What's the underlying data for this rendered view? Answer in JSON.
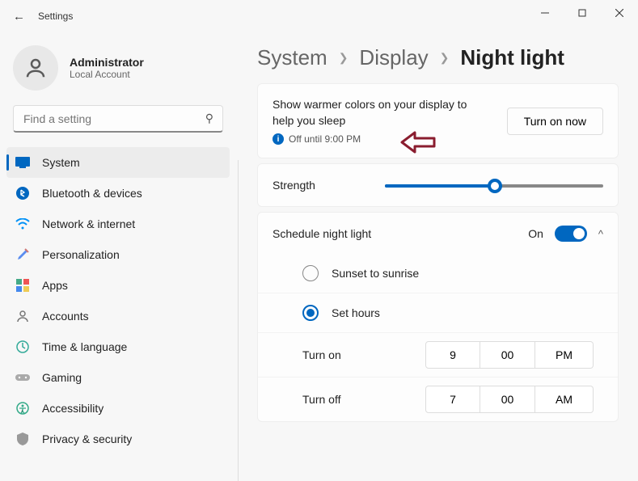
{
  "window": {
    "title": "Settings"
  },
  "profile": {
    "name": "Administrator",
    "type": "Local Account"
  },
  "search": {
    "placeholder": "Find a setting"
  },
  "nav": {
    "items": [
      {
        "label": "System"
      },
      {
        "label": "Bluetooth & devices"
      },
      {
        "label": "Network & internet"
      },
      {
        "label": "Personalization"
      },
      {
        "label": "Apps"
      },
      {
        "label": "Accounts"
      },
      {
        "label": "Time & language"
      },
      {
        "label": "Gaming"
      },
      {
        "label": "Accessibility"
      },
      {
        "label": "Privacy & security"
      }
    ]
  },
  "breadcrumb": {
    "l1": "System",
    "l2": "Display",
    "l3": "Night light"
  },
  "card_desc": "Show warmer colors on your display to help you sleep",
  "status_text": "Off until 9:00 PM",
  "turn_on_label": "Turn on now",
  "strength": {
    "label": "Strength",
    "value_percent": 48
  },
  "schedule": {
    "title": "Schedule night light",
    "state_label": "On",
    "enabled": true,
    "options": {
      "sunset": "Sunset to sunrise",
      "set_hours": "Set hours"
    },
    "selected": "set_hours",
    "turn_on": {
      "label": "Turn on",
      "hour": "9",
      "minute": "00",
      "ampm": "PM"
    },
    "turn_off": {
      "label": "Turn off",
      "hour": "7",
      "minute": "00",
      "ampm": "AM"
    }
  }
}
